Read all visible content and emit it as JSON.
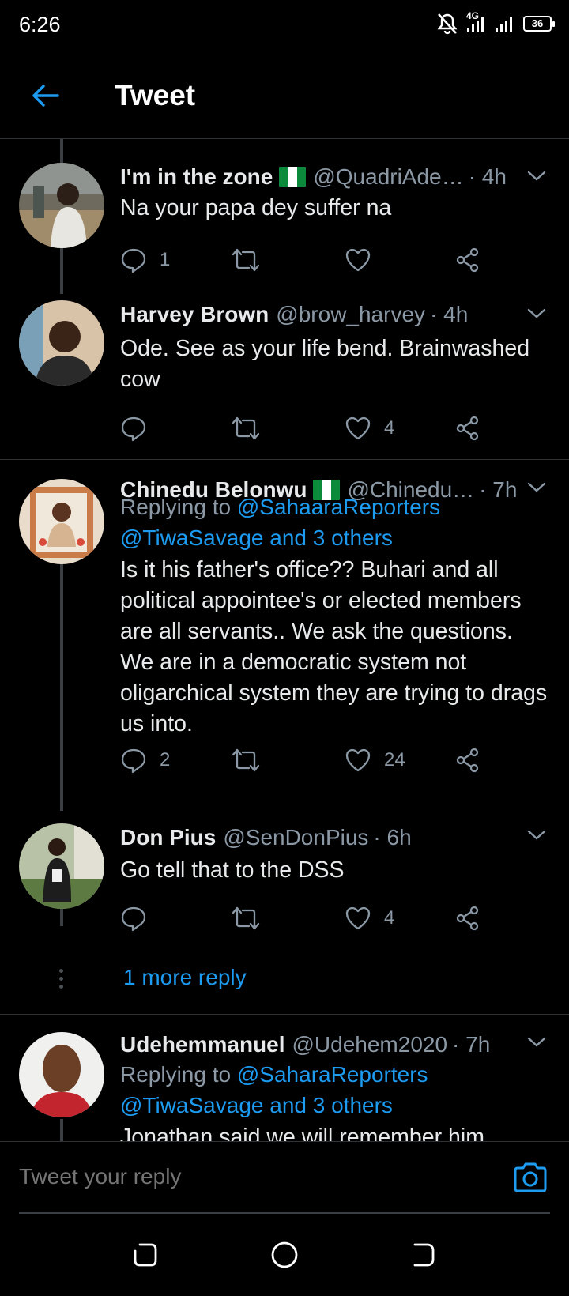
{
  "status_bar": {
    "time": "6:26",
    "network": "4G",
    "battery": "36"
  },
  "header": {
    "title": "Tweet"
  },
  "tweets": [
    {
      "name": "I'm in the zone",
      "handle": "@QuadriAde…",
      "time": "· 4h",
      "text": "Na your papa dey suffer na",
      "reply_count": "1",
      "retweet_count": "",
      "like_count": ""
    },
    {
      "name": "Harvey Brown",
      "handle": "@brow_harvey",
      "time": "· 4h",
      "text": "Ode. See as your life bend. Brainwashed cow",
      "reply_count": "",
      "retweet_count": "",
      "like_count": "4"
    },
    {
      "name": "Chinedu Belonwu",
      "handle": "@Chinedu…",
      "time": "· 7h",
      "replying_prefix": "Replying to ",
      "replying_link1": "@SahaaraReporters",
      "replying_link2": "@TiwaSavage and 3 others",
      "text": "Is it his father's office?? Buhari and all political appointee's or elected members are all servants.. We ask the questions. We are in a democratic system not oligarchical system they are trying to drags us into.",
      "reply_count": "2",
      "retweet_count": "",
      "like_count": "24"
    },
    {
      "name": "Don Pius",
      "handle": "@SenDonPius",
      "time": "· 6h",
      "text": "Go tell that to the DSS",
      "reply_count": "",
      "retweet_count": "",
      "like_count": "4"
    },
    {
      "name": "Udehemmanuel",
      "handle": "@Udehem2020",
      "time": "· 7h",
      "replying_prefix": "Replying to ",
      "replying_link1": "@SaharaReporters",
      "replying_link2": "@TiwaSavage and 3 others",
      "text": "Jonathan said we will remember him"
    }
  ],
  "more_replies": "1 more reply",
  "composer": {
    "placeholder": "Tweet your reply"
  },
  "colors": {
    "accent": "#1d9bf0",
    "background": "#000000",
    "muted": "#8b98a5"
  },
  "icons": [
    "back-arrow-icon",
    "reply-icon",
    "retweet-icon",
    "like-icon",
    "share-icon",
    "chevron-down-icon",
    "camera-icon",
    "nigeria-flag-icon"
  ]
}
